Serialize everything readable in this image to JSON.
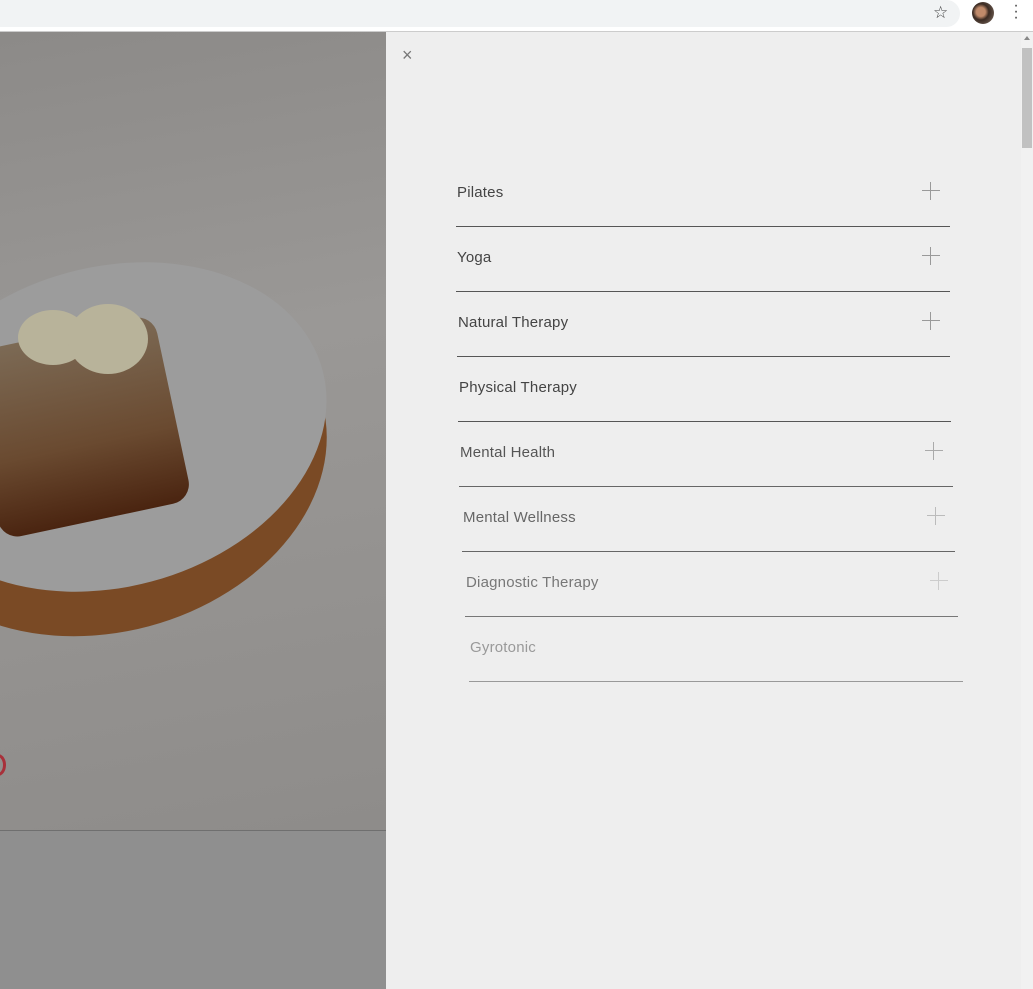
{
  "browser": {
    "star_icon": "star-icon",
    "menu_icon": "kebab-menu-icon"
  },
  "panel": {
    "close_icon": "×",
    "items": [
      {
        "label": "Pilates",
        "expandable": true
      },
      {
        "label": "Yoga",
        "expandable": true
      },
      {
        "label": "Natural Therapy",
        "expandable": true
      },
      {
        "label": "Physical Therapy",
        "expandable": false
      },
      {
        "label": "Mental Health",
        "expandable": true
      },
      {
        "label": "Mental Wellness",
        "expandable": true
      },
      {
        "label": "Diagnostic Therapy",
        "expandable": true
      },
      {
        "label": "Gyrotonic",
        "expandable": false
      }
    ]
  }
}
